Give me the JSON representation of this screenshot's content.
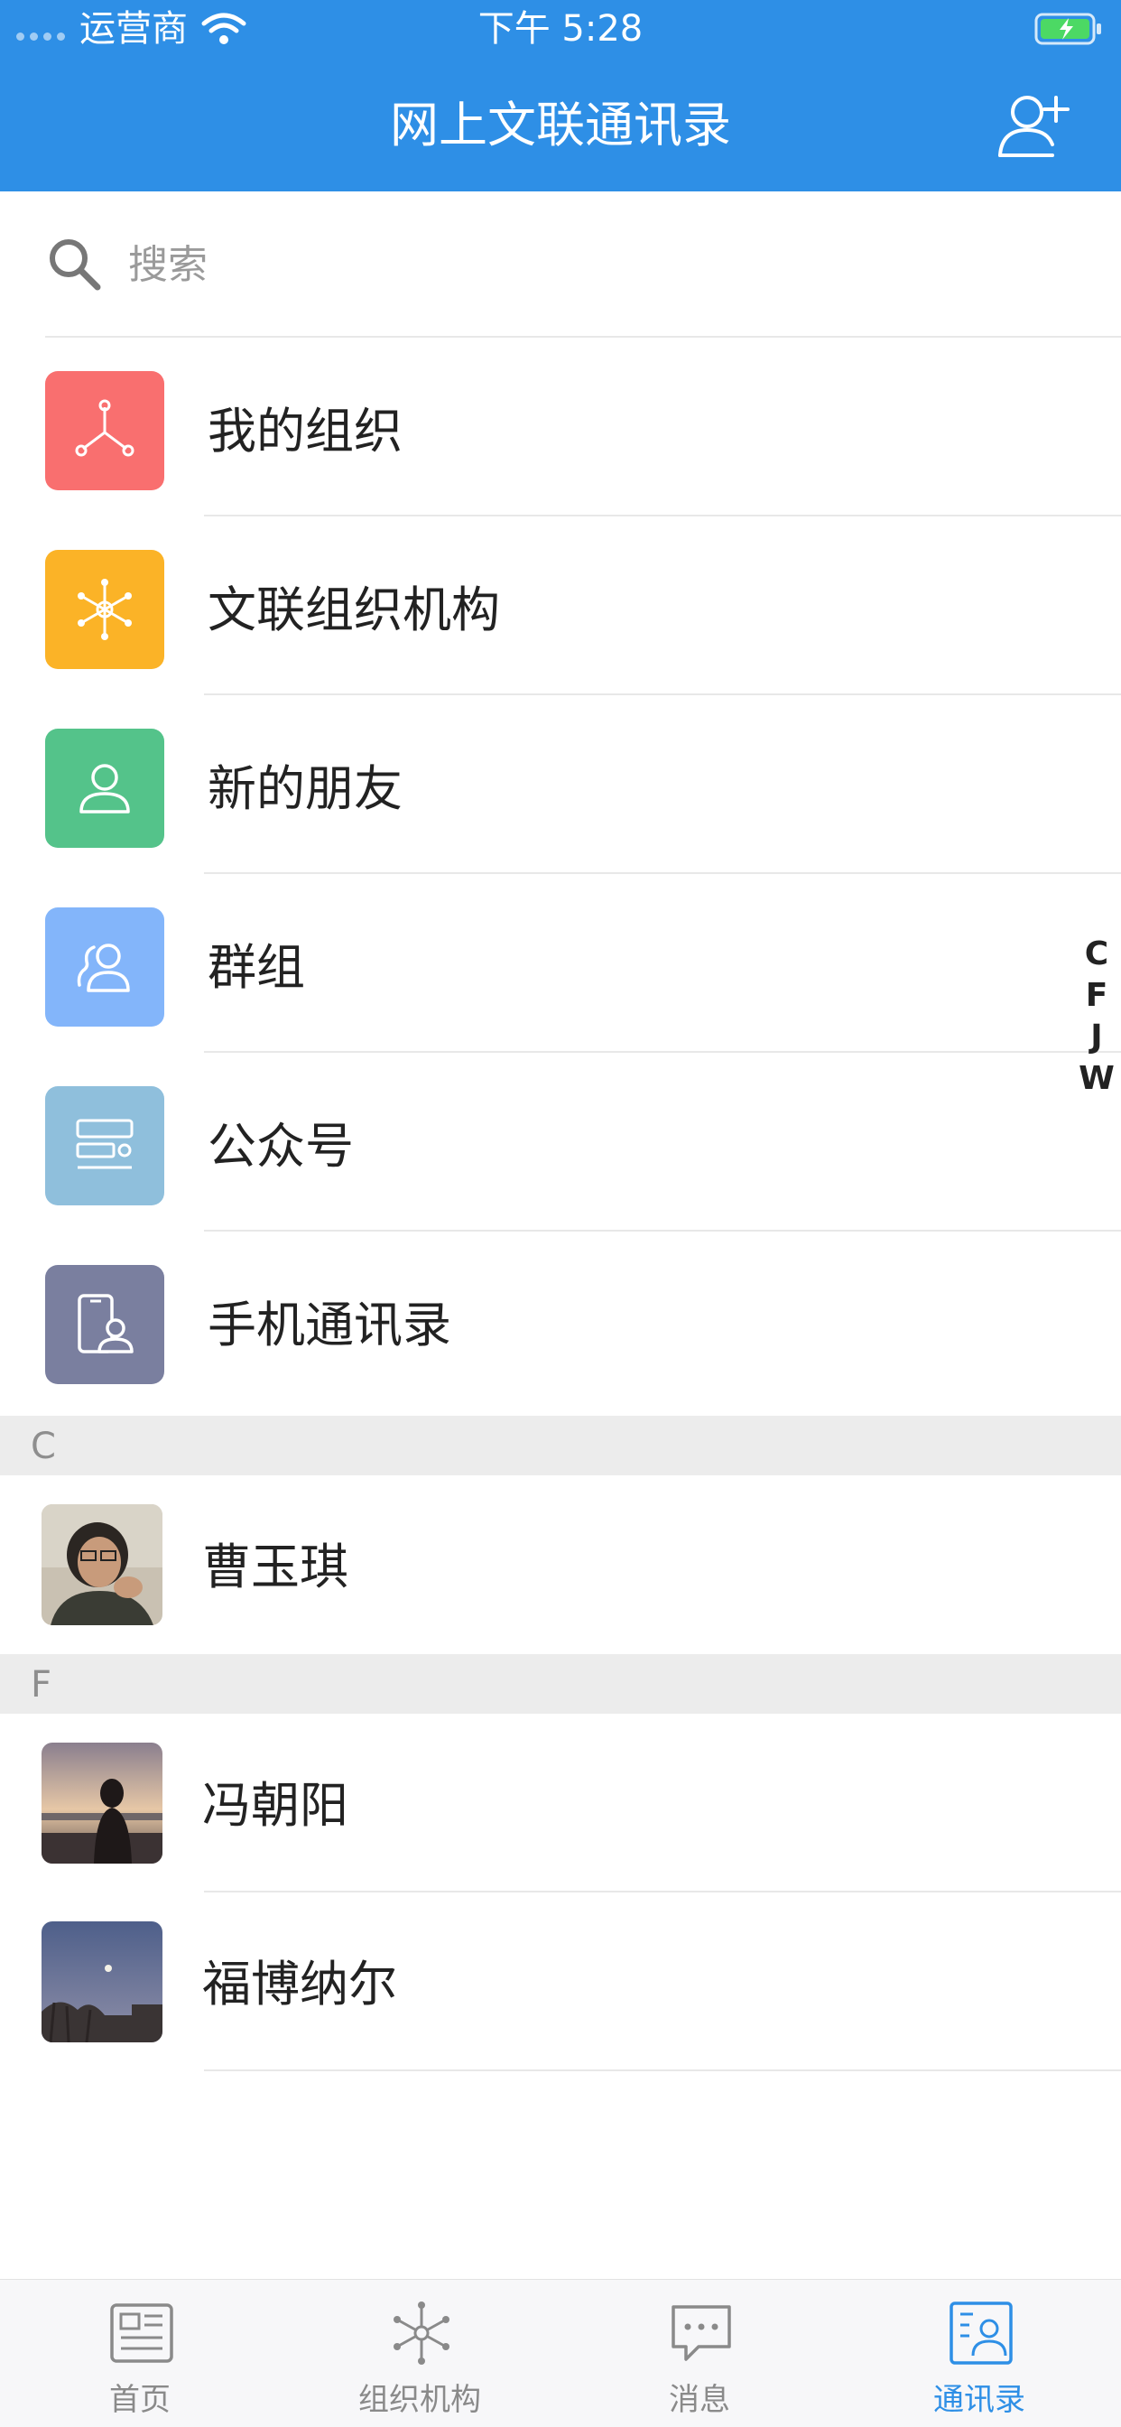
{
  "status_bar": {
    "carrier": "运营商",
    "time": "下午 5:28"
  },
  "header": {
    "title": "网上文联通讯录",
    "action_icon": "add-friend-icon"
  },
  "search": {
    "placeholder": "搜索"
  },
  "menu_items": [
    {
      "label": "我的组织",
      "icon": "organization-tree-icon",
      "color": "#f96f6f"
    },
    {
      "label": "文联组织机构",
      "icon": "network-icon",
      "color": "#fbb327"
    },
    {
      "label": "新的朋友",
      "icon": "person-icon",
      "color": "#54c38a"
    },
    {
      "label": "群组",
      "icon": "group-icon",
      "color": "#83b5fa"
    },
    {
      "label": "公众号",
      "icon": "official-account-icon",
      "color": "#8fbfdc"
    },
    {
      "label": "手机通讯录",
      "icon": "phone-contacts-icon",
      "color": "#7a7f9f"
    }
  ],
  "sections": [
    {
      "letter": "C",
      "contacts": [
        {
          "name": "曹玉琪"
        }
      ]
    },
    {
      "letter": "F",
      "contacts": [
        {
          "name": "冯朝阳"
        },
        {
          "name": "福博纳尔"
        }
      ]
    }
  ],
  "index_letters": [
    "C",
    "F",
    "J",
    "W"
  ],
  "tabs": [
    {
      "label": "首页",
      "icon": "home-news-icon",
      "active": false
    },
    {
      "label": "组织机构",
      "icon": "organization-icon",
      "active": false
    },
    {
      "label": "消息",
      "icon": "message-icon",
      "active": false
    },
    {
      "label": "通讯录",
      "icon": "contacts-icon",
      "active": true
    }
  ],
  "colors": {
    "primary": "#2e8fe6",
    "section_bg": "#ececec",
    "tab_inactive": "#8a8a8a"
  }
}
